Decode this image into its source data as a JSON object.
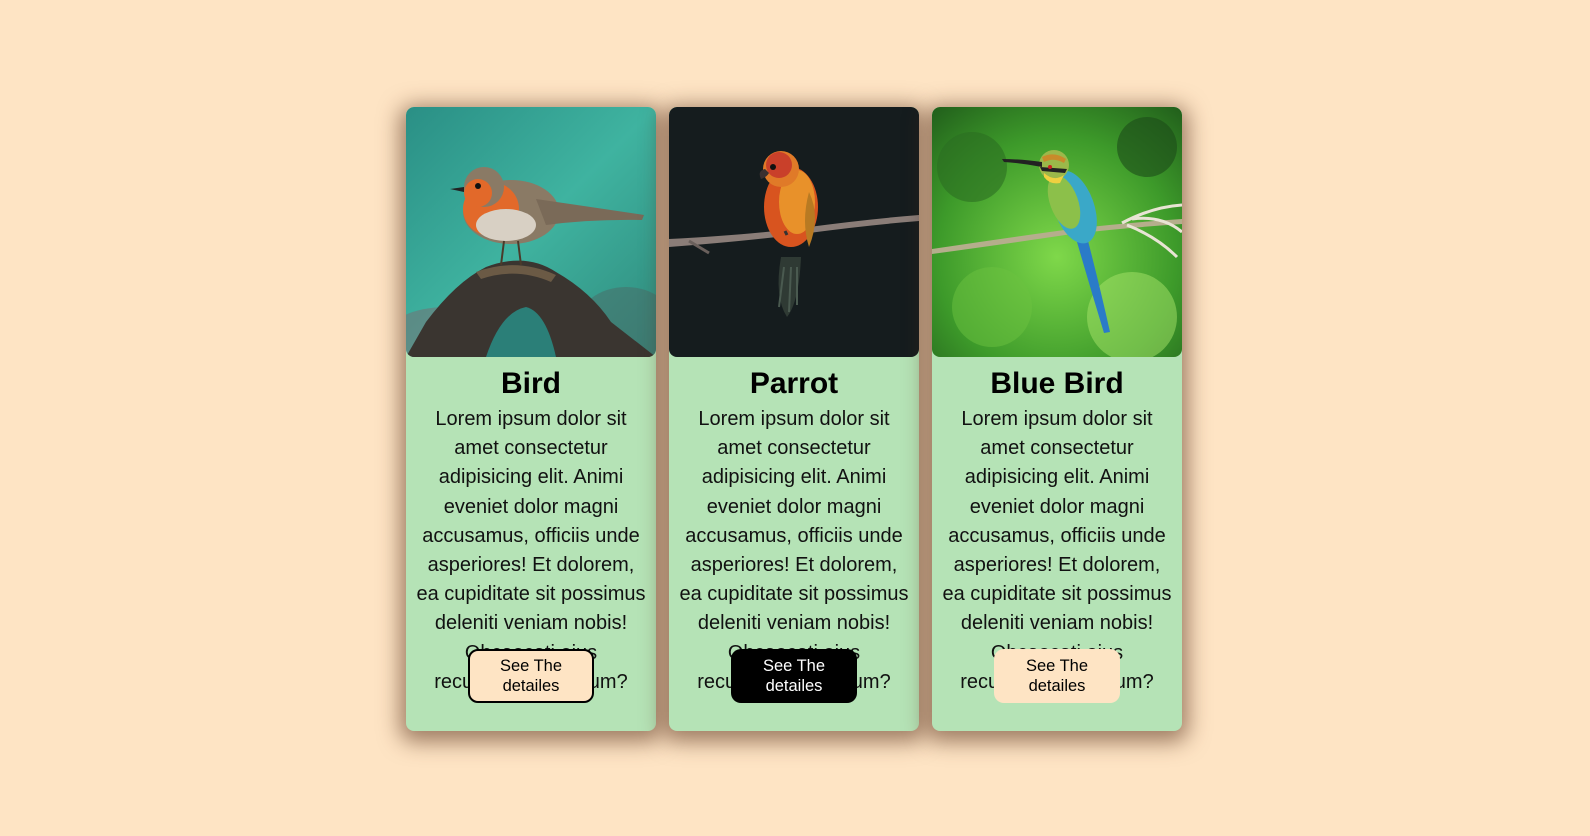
{
  "cards": [
    {
      "title": "Bird",
      "description": "Lorem ipsum dolor sit amet consectetur adipisicing elit. Animi eveniet dolor magni accusamus, officiis unde asperiores! Et dolorem, ea cupiditate sit possimus deleniti veniam nobis! Obcaecati eius recusandae nostrum?",
      "button_label": "See The detailes",
      "image": "robin-photo"
    },
    {
      "title": "Parrot",
      "description": "Lorem ipsum dolor sit amet consectetur adipisicing elit. Animi eveniet dolor magni accusamus, officiis unde asperiores! Et dolorem, ea cupiditate sit possimus deleniti veniam nobis! Obcaecati eius recusandae nostrum?",
      "button_label": "See The detailes",
      "image": "parrot-photo"
    },
    {
      "title": "Blue Bird",
      "description": "Lorem ipsum dolor sit amet consectetur adipisicing elit. Animi eveniet dolor magni accusamus, officiis unde asperiores! Et dolorem, ea cupiditate sit possimus deleniti veniam nobis! Obcaecati eius recusandae nostrum?",
      "button_label": "See The detailes",
      "image": "bee-eater-photo"
    }
  ],
  "colors": {
    "page_background": "#fee4c4",
    "card_background": "#b5e3b6",
    "button_light": "#fee4c4",
    "button_dark": "#000000"
  }
}
